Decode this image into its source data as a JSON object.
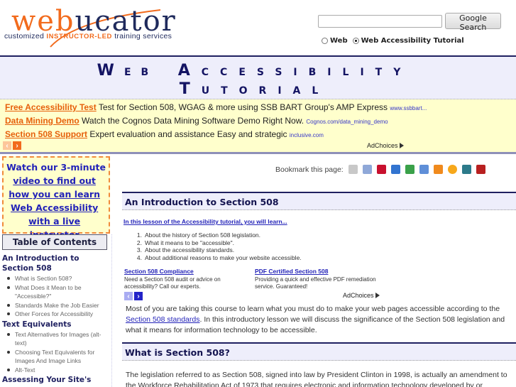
{
  "header": {
    "logo": {
      "word_part1": "web",
      "word_part2": "ucator",
      "tagline_prefix": "customized",
      "tagline_highlight": "INSTRUCTOR-LED",
      "tagline_suffix": "training services"
    },
    "search": {
      "input_value": "",
      "button_label": "Google Search",
      "options": [
        {
          "label": "Web",
          "selected": false
        },
        {
          "label": "Web Accessibility Tutorial",
          "selected": true
        }
      ]
    }
  },
  "banner": {
    "line1": [
      {
        "first": "W",
        "rest": "EB"
      },
      {
        "first": "A",
        "rest": "CCESSIBILITY"
      }
    ],
    "line2": [
      {
        "first": "T",
        "rest": "UTORIAL"
      }
    ]
  },
  "top_ads": {
    "items": [
      {
        "title": "Free Accessibility Test",
        "text": "Test for Section 508, WGAG & more using SSB BART Group's AMP Express",
        "url": "www.ssbbart..."
      },
      {
        "title": "Data Mining Demo",
        "text": "Watch the Cognos Data Mining Software Demo Right Now.",
        "url": "Cognos.com/data_mining_demo"
      },
      {
        "title": "Section 508 Support",
        "text": "Expert evaluation and assistance Easy and strategic",
        "url": "inclusive.com"
      }
    ],
    "prev_icon": "‹",
    "next_icon": "›",
    "adchoices_label": "AdChoices"
  },
  "sidebar": {
    "promo": {
      "line1": "Watch our 3-minute",
      "link_text": "video to find out how you can learn Web Accessibility with a live instructor",
      "suffix": "."
    },
    "toc_title": "Table of Contents",
    "toc": [
      {
        "heading": "An Introduction to Section 508",
        "items": [
          "What is Section 508?",
          "What Does it Mean to be \"Accessible?\"",
          "Standards Make the Job Easier",
          "Other Forces for Accessibility"
        ]
      },
      {
        "heading": "Text Equivalents",
        "items": [
          "Text Alternatives for Images (alt-text)",
          "Choosing Text Equivalents for Images And Image Links",
          "Alt-Text"
        ]
      },
      {
        "heading": "Assessing Your Site's",
        "items": []
      }
    ]
  },
  "main": {
    "bookmark_label": "Bookmark this page:",
    "bookmark_icons": [
      {
        "name": "delicious-people-icon",
        "color": "#c8c8c8"
      },
      {
        "name": "reddit-icon",
        "color": "#8fa8d8"
      },
      {
        "name": "yahoo-icon",
        "color": "#c8102e"
      },
      {
        "name": "delicious-icon",
        "color": "#3274d0"
      },
      {
        "name": "stumbleupon-icon",
        "color": "#3aa14a"
      },
      {
        "name": "slashdot-icon",
        "color": "#5f8fd8"
      },
      {
        "name": "furl-icon",
        "color": "#f08a1d"
      },
      {
        "name": "technorati-icon",
        "color": "#f7a81b"
      },
      {
        "name": "ask-icon",
        "color": "#2c7a8a"
      },
      {
        "name": "netvouz-icon",
        "color": "#b82020"
      }
    ],
    "section1_title": "An Introduction to Section 508",
    "lesson_link": "In this lesson of the Accessibility tutorial, you will learn...",
    "learn_items": [
      "About the history of Section 508 legislation.",
      "What it means to be \"accessible\".",
      "About the accessibility standards.",
      "About additional reasons to make your website accessible."
    ],
    "inline_ads": [
      {
        "title": "Section 508 Compliance",
        "text": "Need a Section 508 audit or advice on accessibility? Call our experts."
      },
      {
        "title": "PDF Certified Section 508",
        "text": "Providing a quick and effective PDF remediation service. Guaranteed!"
      }
    ],
    "inline_adchoices": "AdChoices",
    "intro_para": {
      "before": "Most of you are taking this course to learn what you must do to make your web pages accessible according to the ",
      "link": "Section 508 standards",
      "after": ". In this introductory lesson we will discuss the significance of the Section 508 legislation and what it means for information technology to be accessible."
    },
    "section2_title": "What is Section 508?",
    "section2_para": "The legislation referred to as Section 508, signed into law by President Clinton in 1998, is actually an amendment to the Workforce Rehabilitation Act of 1973 that requires electronic and information technology developed by or"
  }
}
